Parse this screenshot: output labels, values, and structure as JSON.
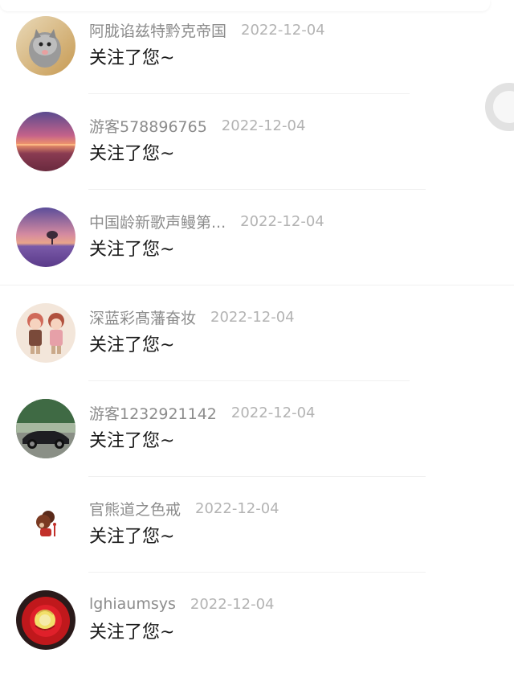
{
  "notifications": [
    {
      "username": "阿胧谄兹特黔克帝国",
      "date": "2022-12-04",
      "message": "关注了您~",
      "avatar": "kitten-avatar"
    },
    {
      "username": "游客578896765",
      "date": "2022-12-04",
      "message": "关注了您~",
      "avatar": "sunset-sea-avatar"
    },
    {
      "username": "中国龄新歌声鳗第...",
      "date": "2022-12-04",
      "message": "关注了您~",
      "avatar": "lavender-field-avatar"
    },
    {
      "username": "深蓝彩髙藩奋妆",
      "date": "2022-12-04",
      "message": "关注了您~",
      "avatar": "cartoon-kids-avatar"
    },
    {
      "username": "游客1232921142",
      "date": "2022-12-04",
      "message": "关注了您~",
      "avatar": "classic-car-avatar"
    },
    {
      "username": "官熊道之色戒",
      "date": "2022-12-04",
      "message": "关注了您~",
      "avatar": "cartoon-figure-avatar"
    },
    {
      "username": "lghiaumsys",
      "date": "2022-12-04",
      "message": "关注了您~",
      "avatar": "red-rose-avatar"
    }
  ],
  "colors": {
    "username": "#8c8c8c",
    "date": "#b3b3b3",
    "message": "#1a1a1a",
    "divider": "#f0f0f0",
    "background": "#ffffff"
  }
}
